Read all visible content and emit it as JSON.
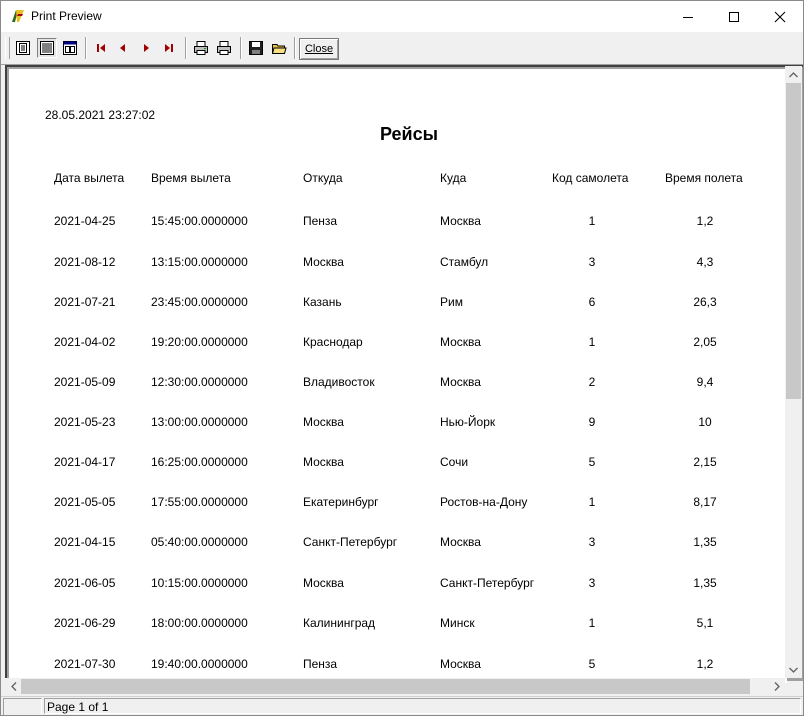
{
  "window": {
    "title": "Print Preview"
  },
  "toolbar": {
    "buttons": [
      "whole-page",
      "page-width",
      "multiple-pages",
      "first-page",
      "previous-page",
      "next-page",
      "last-page",
      "print-setup",
      "print",
      "save",
      "open"
    ],
    "close_label": "Close"
  },
  "report": {
    "datetime": "28.05.2021 23:27:02",
    "title": "Рейсы",
    "columns": [
      "Дата вылета",
      "Время вылета",
      "Откуда",
      "Куда",
      "Код самолета",
      "Время полета"
    ],
    "rows": [
      [
        "2021-04-25",
        "15:45:00.0000000",
        "Пенза",
        "Москва",
        "1",
        "1,2"
      ],
      [
        "2021-08-12",
        "13:15:00.0000000",
        "Москва",
        "Стамбул",
        "3",
        "4,3"
      ],
      [
        "2021-07-21",
        "23:45:00.0000000",
        "Казань",
        "Рим",
        "6",
        "26,3"
      ],
      [
        "2021-04-02",
        "19:20:00.0000000",
        "Краснодар",
        "Москва",
        "1",
        "2,05"
      ],
      [
        "2021-05-09",
        "12:30:00.0000000",
        "Владивосток",
        "Москва",
        "2",
        "9,4"
      ],
      [
        "2021-05-23",
        "13:00:00.0000000",
        "Москва",
        "Нью-Йорк",
        "9",
        "10"
      ],
      [
        "2021-04-17",
        "16:25:00.0000000",
        "Москва",
        "Сочи",
        "5",
        "2,15"
      ],
      [
        "2021-05-05",
        "17:55:00.0000000",
        "Екатеринбург",
        "Ростов-на-Дону",
        "1",
        "8,17"
      ],
      [
        "2021-04-15",
        "05:40:00.0000000",
        "Санкт-Петербург",
        "Москва",
        "3",
        "1,35"
      ],
      [
        "2021-06-05",
        "10:15:00.0000000",
        "Москва",
        "Санкт-Петербург",
        "3",
        "1,35"
      ],
      [
        "2021-06-29",
        "18:00:00.0000000",
        "Калининград",
        "Минск",
        "1",
        "5,1"
      ],
      [
        "2021-07-30",
        "19:40:00.0000000",
        "Пенза",
        "Москва",
        "5",
        "1,2"
      ]
    ]
  },
  "status": {
    "page": "Page 1 of 1"
  }
}
